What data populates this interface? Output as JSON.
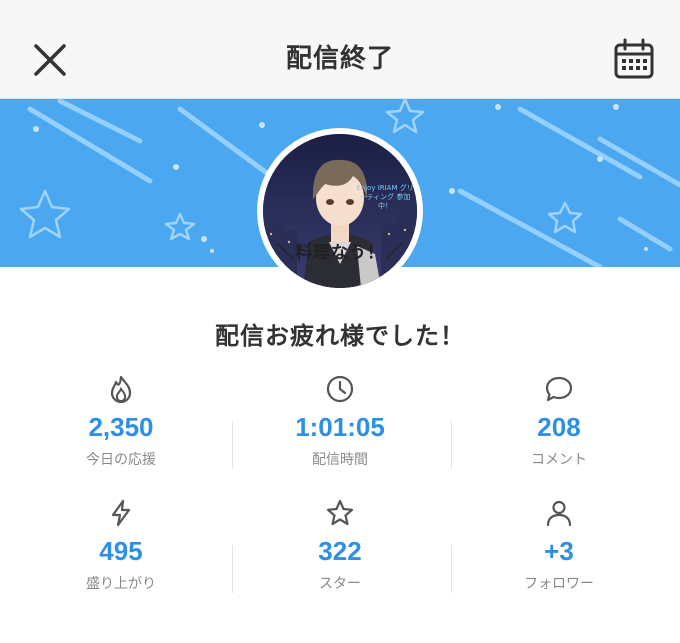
{
  "header": {
    "title": "配信終了"
  },
  "avatar": {
    "caption": "＼料理なう！／",
    "tag_text": "Enjoy IRIAM グリーティング 参加中！"
  },
  "summary": {
    "message": "配信お疲れ様でした！"
  },
  "stats": [
    {
      "value": "2,350",
      "label": "今日の応援",
      "icon": "flame-icon"
    },
    {
      "value": "1:01:05",
      "label": "配信時間",
      "icon": "clock-icon"
    },
    {
      "value": "208",
      "label": "コメント",
      "icon": "comment-icon"
    },
    {
      "value": "495",
      "label": "盛り上がり",
      "icon": "lightning-icon"
    },
    {
      "value": "322",
      "label": "スター",
      "icon": "star-icon"
    },
    {
      "value": "+3",
      "label": "フォロワー",
      "icon": "person-icon"
    }
  ],
  "colors": {
    "accent": "#2d8fe6",
    "banner": "#4aa7f0",
    "header_bg": "#f7f7f7"
  }
}
